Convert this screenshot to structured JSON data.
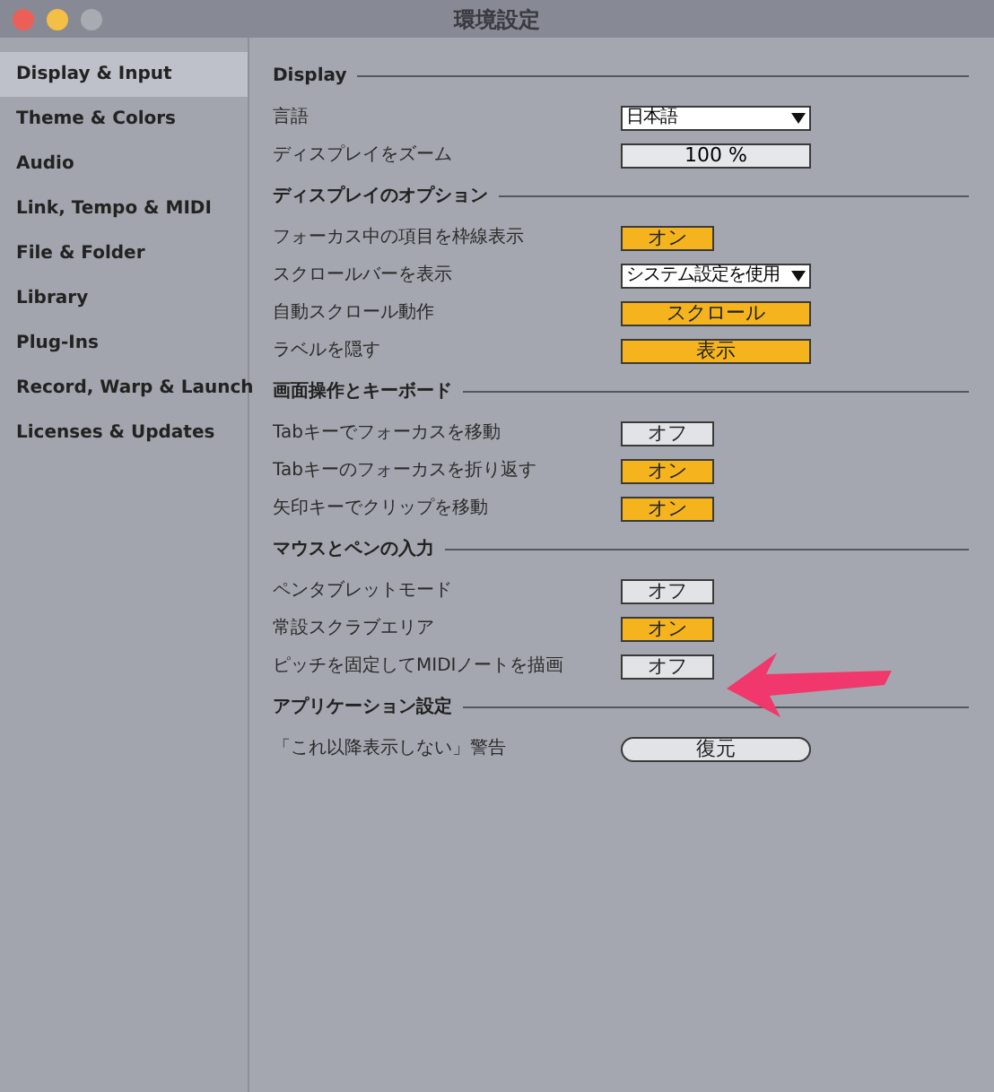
{
  "window": {
    "title": "環境設定"
  },
  "sidebar": {
    "items": [
      {
        "label": "Display & Input",
        "selected": true
      },
      {
        "label": "Theme & Colors",
        "selected": false
      },
      {
        "label": "Audio",
        "selected": false
      },
      {
        "label": "Link, Tempo & MIDI",
        "selected": false
      },
      {
        "label": "File & Folder",
        "selected": false
      },
      {
        "label": "Library",
        "selected": false
      },
      {
        "label": "Plug-Ins",
        "selected": false
      },
      {
        "label": "Record, Warp & Launch",
        "selected": false
      },
      {
        "label": "Licenses & Updates",
        "selected": false
      }
    ]
  },
  "sections": [
    {
      "title": "Display",
      "rows": [
        {
          "label": "言語",
          "kind": "dropdown",
          "value": "日本語"
        },
        {
          "label": "ディスプレイをズーム",
          "kind": "zoom",
          "value": "100 %"
        }
      ]
    },
    {
      "title": "ディスプレイのオプション",
      "rows": [
        {
          "label": "フォーカス中の項目を枠線表示",
          "kind": "toggle",
          "value": "オン",
          "on": true
        },
        {
          "label": "スクロールバーを表示",
          "kind": "dropdown",
          "value": "システム設定を使用"
        },
        {
          "label": "自動スクロール動作",
          "kind": "wide_toggle",
          "value": "スクロール",
          "on": true
        },
        {
          "label": "ラベルを隠す",
          "kind": "wide_toggle",
          "value": "表示",
          "on": true
        }
      ]
    },
    {
      "title": "画面操作とキーボード",
      "rows": [
        {
          "label": "Tabキーでフォーカスを移動",
          "kind": "toggle",
          "value": "オフ",
          "on": false
        },
        {
          "label": "Tabキーのフォーカスを折り返す",
          "kind": "toggle",
          "value": "オン",
          "on": true
        },
        {
          "label": "矢印キーでクリップを移動",
          "kind": "toggle",
          "value": "オン",
          "on": true
        }
      ]
    },
    {
      "title": "マウスとペンの入力",
      "rows": [
        {
          "label": "ペンタブレットモード",
          "kind": "toggle",
          "value": "オフ",
          "on": false
        },
        {
          "label": "常設スクラブエリア",
          "kind": "toggle",
          "value": "オン",
          "on": true
        },
        {
          "label": "ピッチを固定してMIDIノートを描画",
          "kind": "toggle",
          "value": "オフ",
          "on": false
        }
      ]
    },
    {
      "title": "アプリケーション設定",
      "rows": [
        {
          "label": "「これ以降表示しない」警告",
          "kind": "button",
          "value": "復元"
        }
      ]
    }
  ]
}
